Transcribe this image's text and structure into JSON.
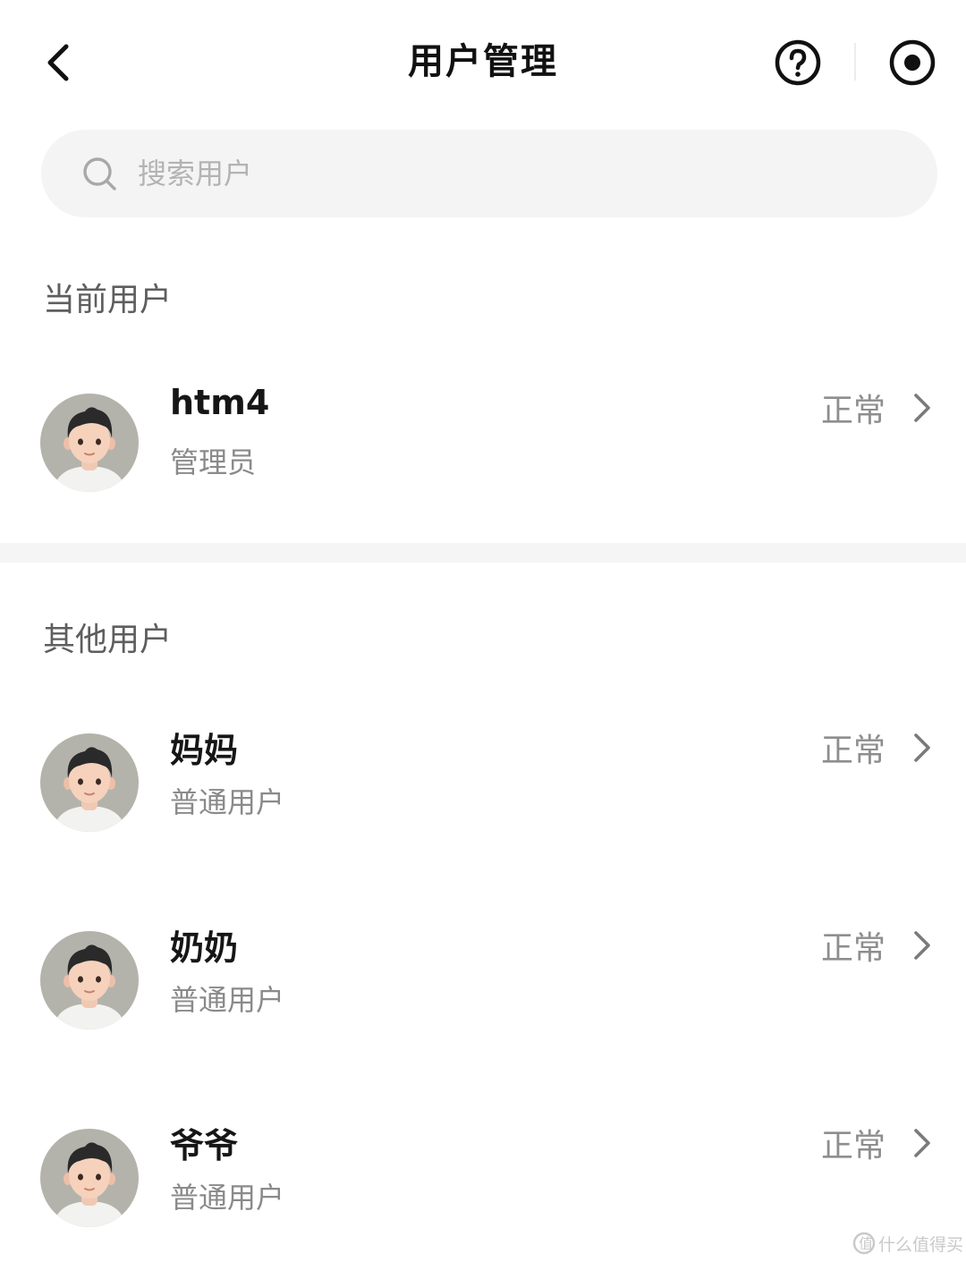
{
  "header": {
    "title": "用户管理"
  },
  "search": {
    "placeholder": "搜索用户"
  },
  "sections": {
    "current_title": "当前用户",
    "others_title": "其他用户"
  },
  "current_user": {
    "name": "htm4",
    "role": "管理员",
    "status": "正常"
  },
  "other_users": [
    {
      "name": "妈妈",
      "role": "普通用户",
      "status": "正常"
    },
    {
      "name": "奶奶",
      "role": "普通用户",
      "status": "正常"
    },
    {
      "name": "爷爷",
      "role": "普通用户",
      "status": "正常"
    }
  ],
  "watermark": {
    "text": "什么值得买"
  },
  "colors": {
    "background": "#ffffff",
    "search_bg": "#f4f4f4",
    "divider": "#f5f5f5",
    "avatar_bg": "#b4b3ab",
    "hair": "#2a2a2a"
  }
}
